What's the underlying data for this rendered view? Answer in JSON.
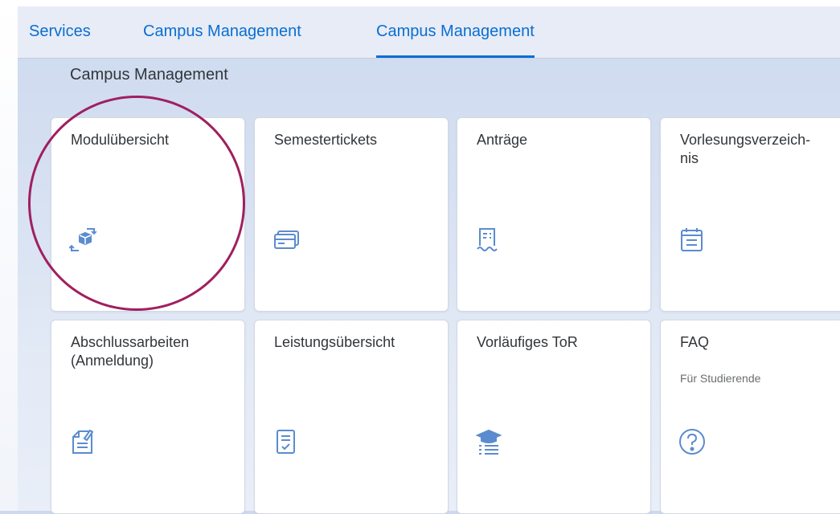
{
  "tabs": [
    {
      "label": "Services",
      "active": false
    },
    {
      "label": "Campus Management",
      "active": false
    },
    {
      "label": "Campus Management",
      "active": true
    }
  ],
  "section_title": "Campus Management",
  "tiles": [
    {
      "title": "Modulübersicht",
      "icon": "module-overview-icon"
    },
    {
      "title": "Semestertickets",
      "icon": "ticket-icon"
    },
    {
      "title": "Anträge",
      "icon": "receipt-icon"
    },
    {
      "title": "Vorlesungsverzeich-\nnis",
      "icon": "calendar-icon"
    },
    {
      "title": "Abschlussarbeiten\n(Anmeldung)",
      "icon": "document-edit-icon"
    },
    {
      "title": "Leistungsübersicht",
      "icon": "checklist-document-icon"
    },
    {
      "title": "Vorläufiges ToR",
      "icon": "graduation-list-icon"
    },
    {
      "title": "FAQ",
      "subtitle": "Für Studierende",
      "icon": "question-mark-icon"
    }
  ],
  "colors": {
    "accent": "#0a6ed1",
    "highlight_circle": "#a01f60",
    "icon": "#5b8ccf"
  }
}
